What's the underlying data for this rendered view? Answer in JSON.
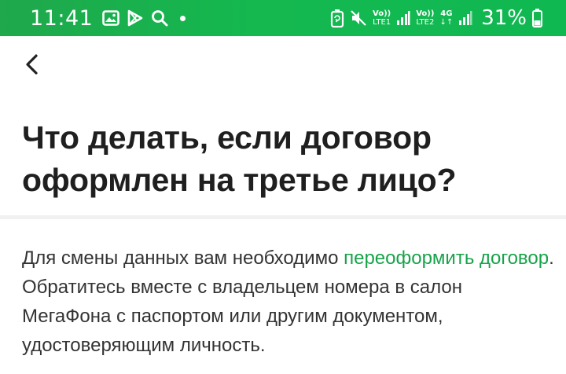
{
  "status_bar": {
    "time": "11:41",
    "icons_left": [
      "gallery-icon",
      "play-store-icon",
      "search-icon",
      "notification-dot-icon"
    ],
    "sim1": {
      "label_top": "Vo))",
      "label_bottom": "LTE1"
    },
    "sim2": {
      "label_top": "Vo))",
      "label_bottom": "LTE2"
    },
    "network_type": "4G",
    "battery_percent": "31%",
    "icons_right": [
      "battery-saver-icon",
      "mute-icon",
      "signal-icon",
      "battery-icon"
    ],
    "background_color": "#14b84f"
  },
  "header": {
    "back_icon": "chevron-left-icon"
  },
  "article": {
    "title": "Что делать, если договор оформлен на третье лицо?",
    "paragraph": {
      "text_before": "Для смены данных вам необходимо ",
      "link_text": "переоформить договор",
      "text_after": ". Обратитесь вместе с владельцем номера в салон МегаФона с паспортом или другим документом, удостоверяющим личность."
    },
    "link_color": "#17a34a"
  }
}
